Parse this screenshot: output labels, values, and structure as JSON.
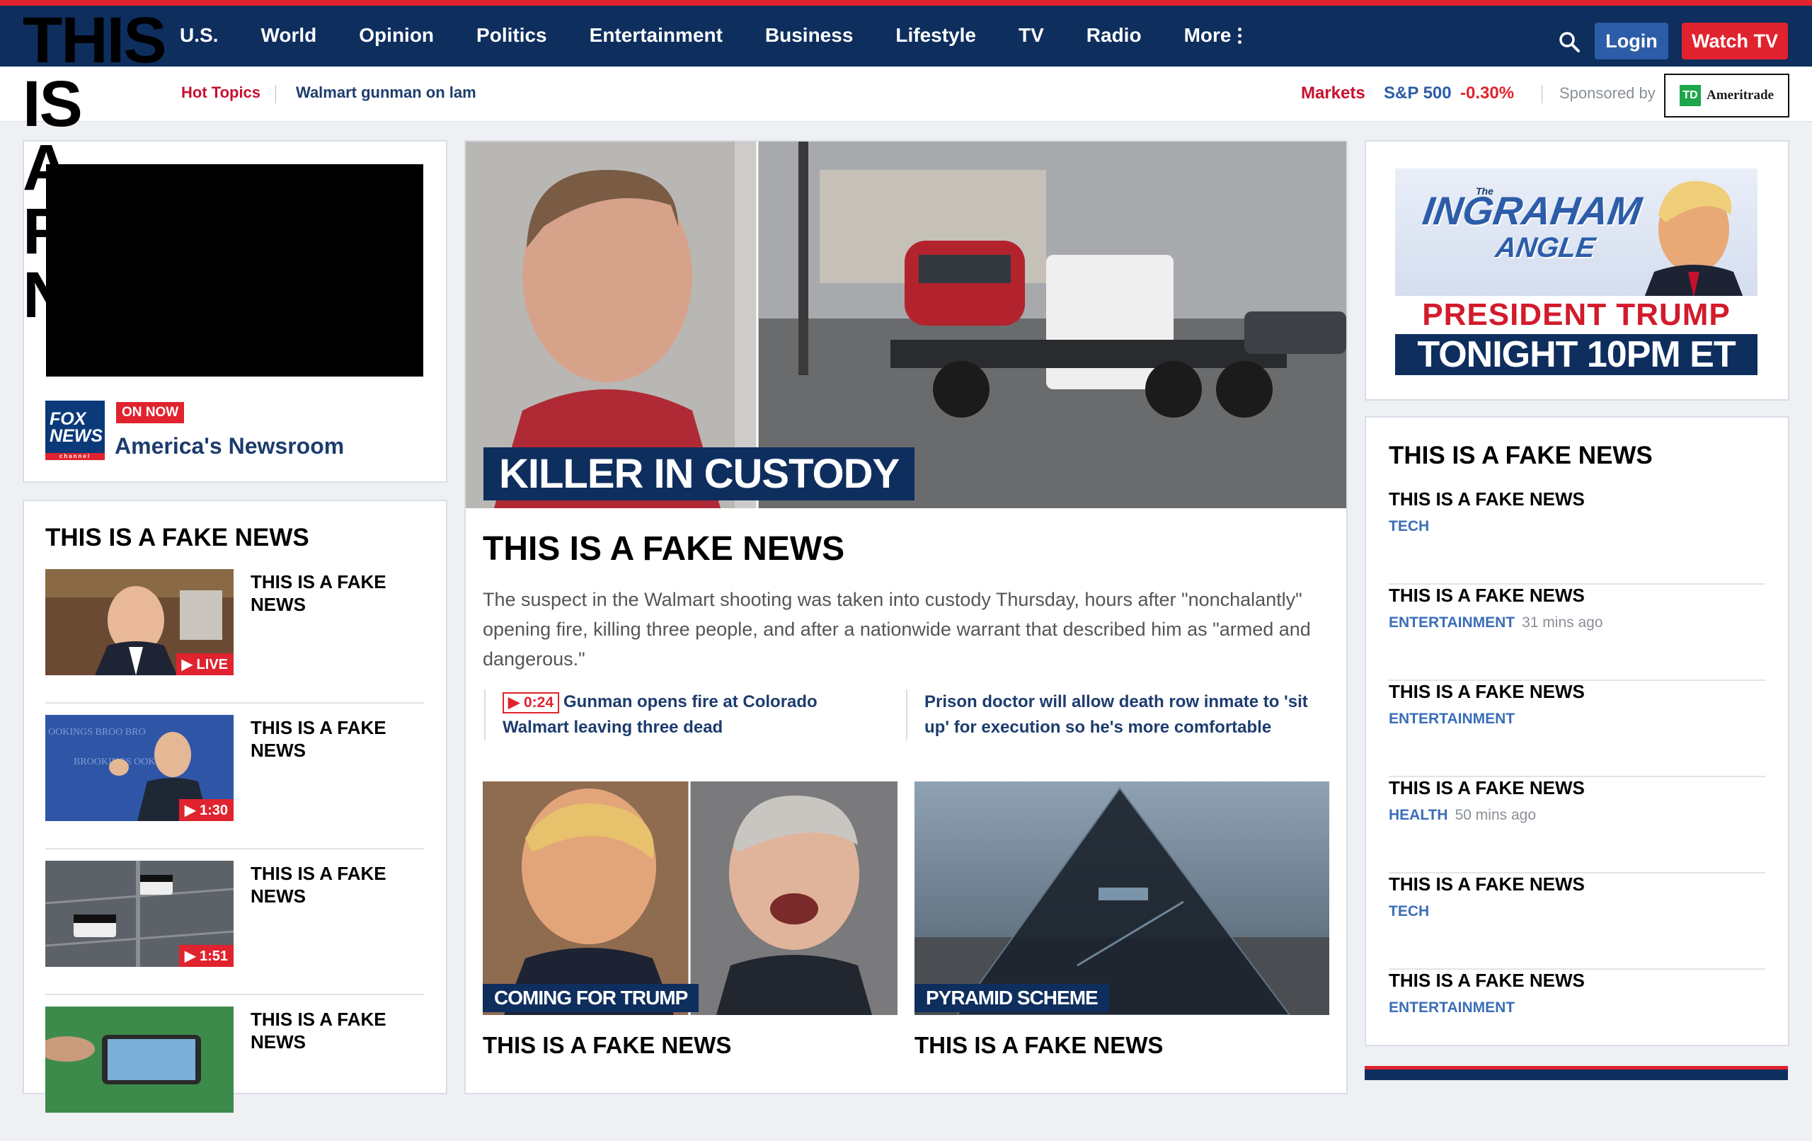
{
  "nav": {
    "items": [
      "U.S.",
      "World",
      "Opinion",
      "Politics",
      "Entertainment",
      "Business",
      "Lifestyle",
      "TV",
      "Radio"
    ],
    "more_label": "More",
    "login_label": "Login",
    "watch_label": "Watch TV"
  },
  "subbar": {
    "hot_label": "Hot Topics",
    "hot_link": "Walmart gunman on lam",
    "markets_label": "Markets",
    "index_name": "S&P 500",
    "index_change": "-0.30%",
    "sponsored_by": "Sponsored by",
    "sponsor_name": "Ameritrade",
    "sponsor_mark": "TD"
  },
  "overlay_title": "THIS IS A FAKE NEWS",
  "overlay_lines": [
    "THIS",
    "IS",
    "A",
    "F",
    "NEWS"
  ],
  "on_now": {
    "badge": "ON NOW",
    "show": "America's Newsroom",
    "logo_line1": "FOX",
    "logo_line2": "NEWS",
    "logo_line3": "channel"
  },
  "left_section": {
    "heading": "THIS IS A FAKE NEWS",
    "items": [
      {
        "title": "THIS IS A FAKE NEWS",
        "badge": "▶ LIVE"
      },
      {
        "title": "THIS IS A FAKE NEWS",
        "badge": "▶ 1:30"
      },
      {
        "title": "THIS IS A FAKE NEWS",
        "badge": "▶ 1:51"
      },
      {
        "title": "THIS IS A FAKE NEWS",
        "badge": ""
      }
    ]
  },
  "hero": {
    "overlay": "KILLER IN CUSTODY",
    "headline": "THIS IS A FAKE NEWS",
    "summary": "The suspect in the Walmart shooting was taken into custody Thursday, hours after \"nonchalantly\" opening fire, killing three people, and after a nationwide warrant that described him as \"armed and dangerous.\"",
    "related": [
      {
        "duration": "▶ 0:24",
        "text": "Gunman opens fire at Colorado Walmart leaving three dead"
      },
      {
        "text": "Prison doctor will allow death row inmate to 'sit up' for execution so he's more comfortable"
      }
    ]
  },
  "cards": [
    {
      "caption": "COMING FOR TRUMP",
      "title": "THIS IS A FAKE NEWS"
    },
    {
      "caption": "PYRAMID SCHEME",
      "title": "THIS IS A FAKE NEWS"
    }
  ],
  "ad": {
    "the": "The",
    "logo1": "INGRAHAM",
    "logo2": "ANGLE",
    "line1": "PRESIDENT TRUMP",
    "line2": "TONIGHT 10PM ET"
  },
  "right_section": {
    "heading": "THIS IS A FAKE NEWS",
    "items": [
      {
        "title": "THIS IS A FAKE NEWS",
        "category": "TECH",
        "time": ""
      },
      {
        "title": "THIS IS A FAKE NEWS",
        "category": "ENTERTAINMENT",
        "time": "31 mins ago"
      },
      {
        "title": "THIS IS A FAKE NEWS",
        "category": "ENTERTAINMENT",
        "time": ""
      },
      {
        "title": "THIS IS A FAKE NEWS",
        "category": "HEALTH",
        "time": "50 mins ago"
      },
      {
        "title": "THIS IS A FAKE NEWS",
        "category": "TECH",
        "time": ""
      },
      {
        "title": "THIS IS A FAKE NEWS",
        "category": "ENTERTAINMENT",
        "time": ""
      }
    ]
  },
  "colors": {
    "navy": "#0e2e5e",
    "red": "#e0232e",
    "link": "#1d3c6e",
    "category": "#3b6eb8"
  },
  "icons": [
    "search-icon",
    "kebab-icon",
    "play-icon"
  ]
}
